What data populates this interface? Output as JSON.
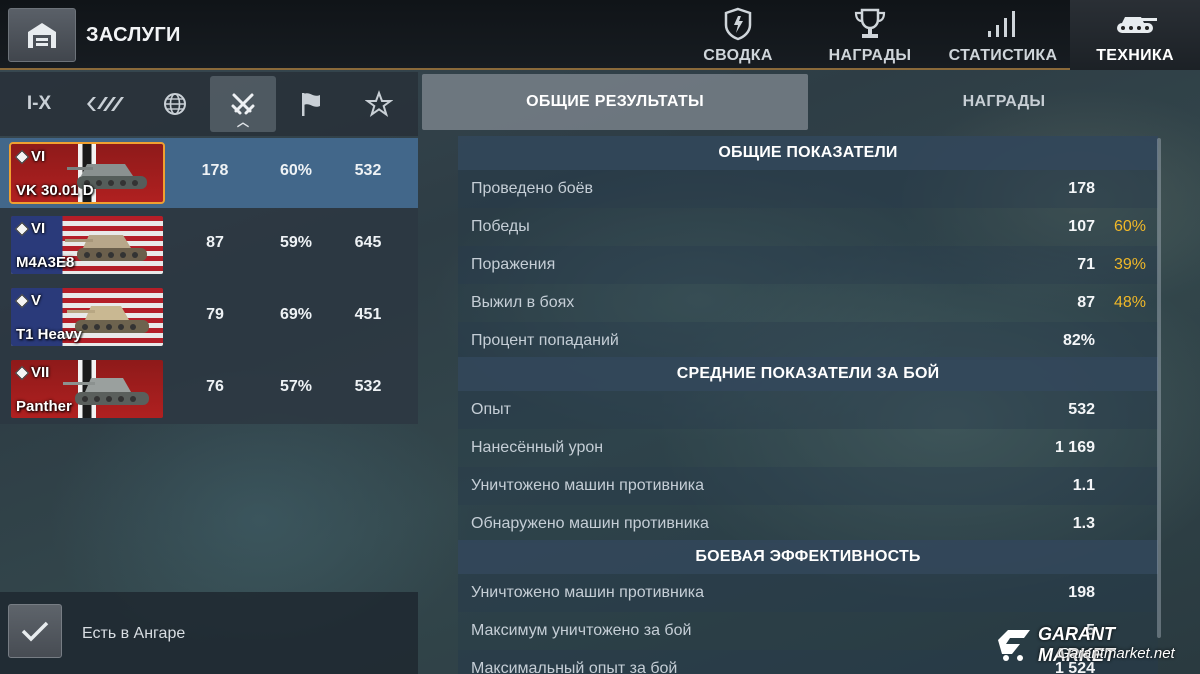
{
  "header": {
    "title": "ЗАСЛУГИ",
    "tabs": [
      {
        "label": "СВОДКА",
        "icon": "shield-icon",
        "active": false
      },
      {
        "label": "НАГРАДЫ",
        "icon": "trophy-icon",
        "active": false
      },
      {
        "label": "СТАТИСТИКА",
        "icon": "bar-chart-icon",
        "active": false
      },
      {
        "label": "ТЕХНИКА",
        "icon": "tank-icon",
        "active": true
      }
    ]
  },
  "filters": {
    "tier_label": "I-X",
    "items": [
      "tier-filter",
      "vehicle-class-icon",
      "nation-globe-icon",
      "crossed-swords-icon",
      "flag-icon",
      "star-icon"
    ],
    "active_index": 3
  },
  "subtabs": {
    "active": "ОБЩИЕ РЕЗУЛЬТАТЫ",
    "inactive": "НАГРАДЫ"
  },
  "vehicles": [
    {
      "tier": "VI",
      "name": "VK 30.01 D",
      "nation": "germany",
      "battles": "178",
      "winrate": "60%",
      "avg_exp": "532",
      "selected": true
    },
    {
      "tier": "VI",
      "name": "M4A3E8",
      "nation": "usa",
      "battles": "87",
      "winrate": "59%",
      "avg_exp": "645",
      "selected": false
    },
    {
      "tier": "V",
      "name": "T1 Heavy",
      "nation": "usa",
      "battles": "79",
      "winrate": "69%",
      "avg_exp": "451",
      "selected": false
    },
    {
      "tier": "VII",
      "name": "Panther",
      "nation": "germany",
      "battles": "76",
      "winrate": "57%",
      "avg_exp": "532",
      "selected": false
    }
  ],
  "hangar_filter": {
    "label": "Есть в Ангаре",
    "checked": true
  },
  "stats": {
    "sections": [
      {
        "title": "ОБЩИЕ ПОКАЗАТЕЛИ",
        "rows": [
          {
            "label": "Проведено боёв",
            "value": "178",
            "pct": ""
          },
          {
            "label": "Победы",
            "value": "107",
            "pct": "60%"
          },
          {
            "label": "Поражения",
            "value": "71",
            "pct": "39%"
          },
          {
            "label": "Выжил в боях",
            "value": "87",
            "pct": "48%"
          },
          {
            "label": "Процент попаданий",
            "value": "82%",
            "pct": ""
          }
        ]
      },
      {
        "title": "СРЕДНИЕ ПОКАЗАТЕЛИ ЗА БОЙ",
        "rows": [
          {
            "label": "Опыт",
            "value": "532",
            "pct": ""
          },
          {
            "label": "Нанесённый урон",
            "value": "1 169",
            "pct": ""
          },
          {
            "label": "Уничтожено машин противника",
            "value": "1.1",
            "pct": ""
          },
          {
            "label": "Обнаружено машин противника",
            "value": "1.3",
            "pct": ""
          }
        ]
      },
      {
        "title": "БОЕВАЯ ЭФФЕКТИВНОСТЬ",
        "rows": [
          {
            "label": "Уничтожено машин противника",
            "value": "198",
            "pct": ""
          },
          {
            "label": "Максимум уничтожено за бой",
            "value": "5",
            "pct": ""
          },
          {
            "label": "Максимальный опыт за бой",
            "value": "1 524",
            "pct": ""
          }
        ]
      }
    ]
  },
  "watermark": {
    "title": "GARANT MARKET",
    "url": "Garantmarket.net"
  },
  "colors": {
    "accent_orange": "#f0a030",
    "percent_yellow": "#f0b828",
    "selected_row": "#46709a"
  }
}
